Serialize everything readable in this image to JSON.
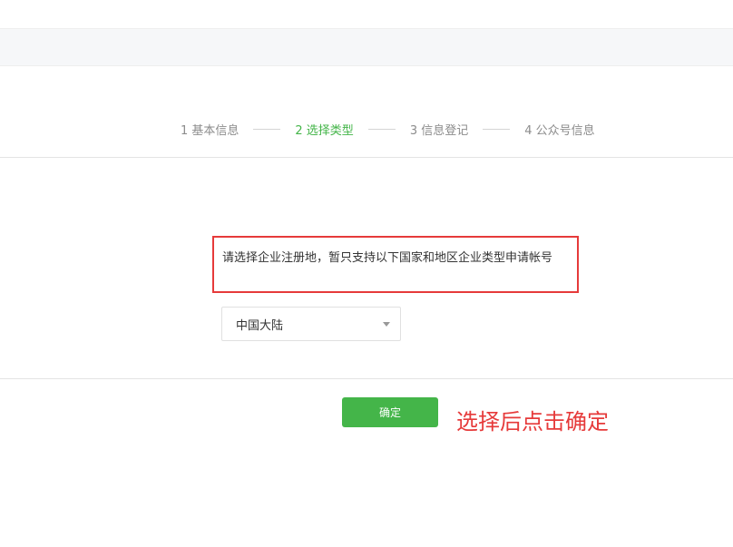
{
  "steps": [
    {
      "label": "1 基本信息",
      "active": false
    },
    {
      "label": "2 选择类型",
      "active": true
    },
    {
      "label": "3 信息登记",
      "active": false
    },
    {
      "label": "4 公众号信息",
      "active": false
    }
  ],
  "notice": {
    "text": "请选择企业注册地，暂只支持以下国家和地区企业类型申请帐号"
  },
  "region_select": {
    "selected": "中国大陆"
  },
  "confirm_button": {
    "label": "确定"
  },
  "annotation": {
    "text": "选择后点击确定"
  },
  "colors": {
    "active_step": "#44b549",
    "button_bg": "#44b549",
    "highlight_border": "#e63a3a",
    "annotation": "#e63a3a"
  }
}
